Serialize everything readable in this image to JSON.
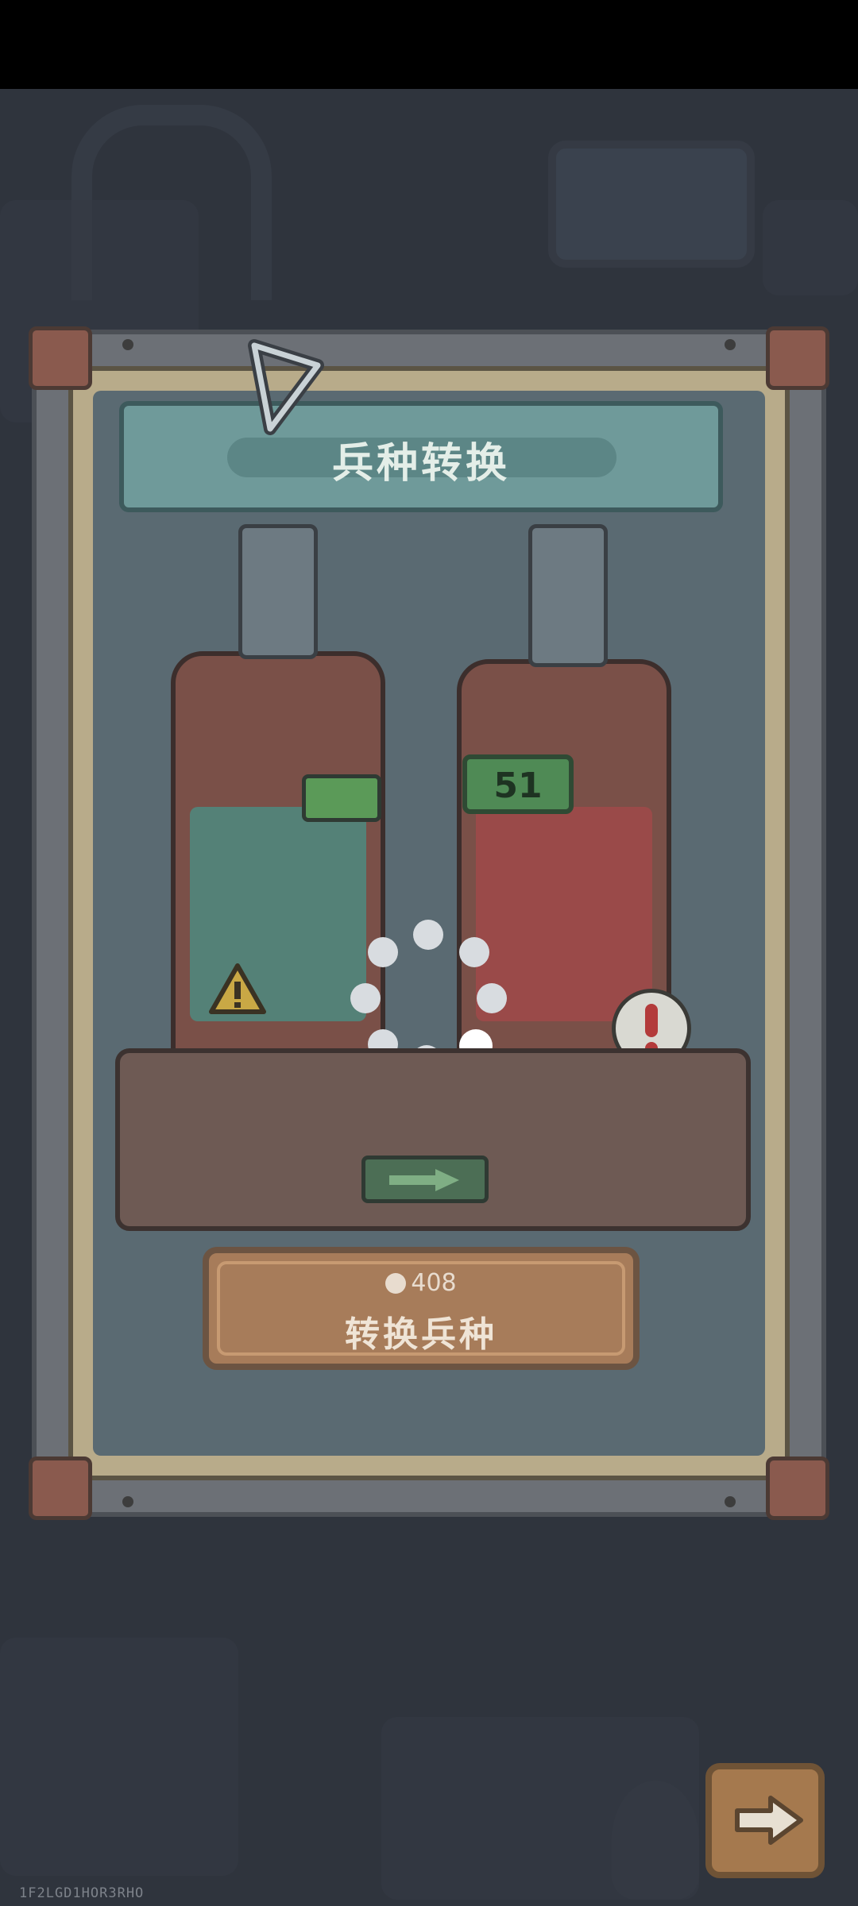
{
  "title": "兵种转换",
  "counter": "51",
  "convert_button": {
    "cost": "408",
    "cost_icon": "brain-icon",
    "label": "转换兵种"
  },
  "next_button": {
    "icon": "arrow-right-icon"
  },
  "build_id": "1F2LGD1HOR3RHO",
  "colors": {
    "banner": "#6f9a9a",
    "button": "#a77c5a",
    "counter": "#4f8a55",
    "left_tank_glass": "#4e8a80",
    "right_tank_glass": "#a0494a"
  }
}
